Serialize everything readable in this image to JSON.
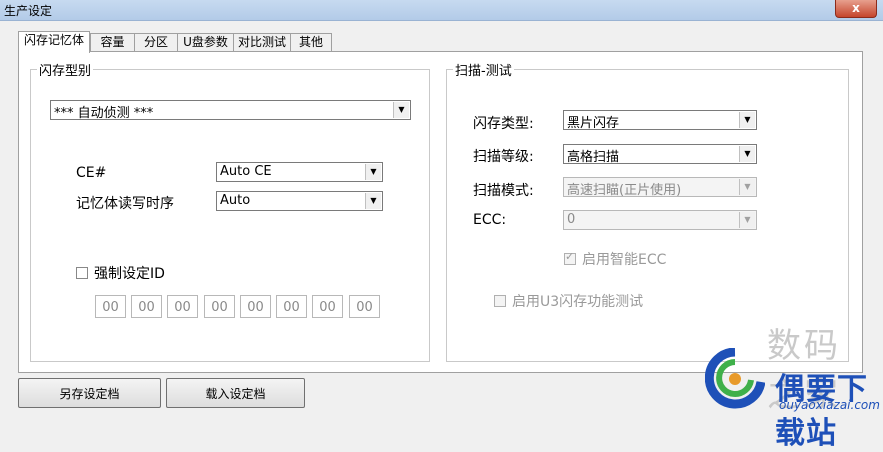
{
  "window": {
    "title": "生产设定",
    "close_glyph": "x"
  },
  "tabs": [
    {
      "label": "闪存记忆体"
    },
    {
      "label": "容量"
    },
    {
      "label": "分区"
    },
    {
      "label": "U盘参数"
    },
    {
      "label": "对比测试"
    },
    {
      "label": "其他"
    }
  ],
  "flash_type_group": {
    "title": "闪存型别",
    "auto_detect": "*** 自动侦测 ***",
    "ce_label": "CE#",
    "ce_value": "Auto CE",
    "rw_timing_label": "记忆体读写时序",
    "rw_timing_value": "Auto",
    "force_id_label": "强制设定ID",
    "id_values": [
      "00",
      "00",
      "00",
      "00",
      "00",
      "00",
      "00",
      "00"
    ]
  },
  "scan_test_group": {
    "title": "扫描-测试",
    "flash_kind_label": "闪存类型:",
    "flash_kind_value": "黑片闪存",
    "scan_level_label": "扫描等级:",
    "scan_level_value": "高格扫描",
    "scan_mode_label": "扫描模式:",
    "scan_mode_value": "高速扫瞄(正片使用)",
    "ecc_label": "ECC:",
    "ecc_value": "0",
    "smart_ecc_label": "启用智能ECC",
    "u3_test_label": "启用U3闪存功能测试"
  },
  "buttons": {
    "save": "另存设定档",
    "load": "载入设定档"
  },
  "watermark": {
    "title": "数码之家",
    "subtitle": "偶要下载站",
    "url": "ouyaoxiazai.com"
  },
  "colors": {
    "watermark_blue": "#1e50b8",
    "titlebar": "#c7daf0",
    "close": "#c5452c"
  }
}
